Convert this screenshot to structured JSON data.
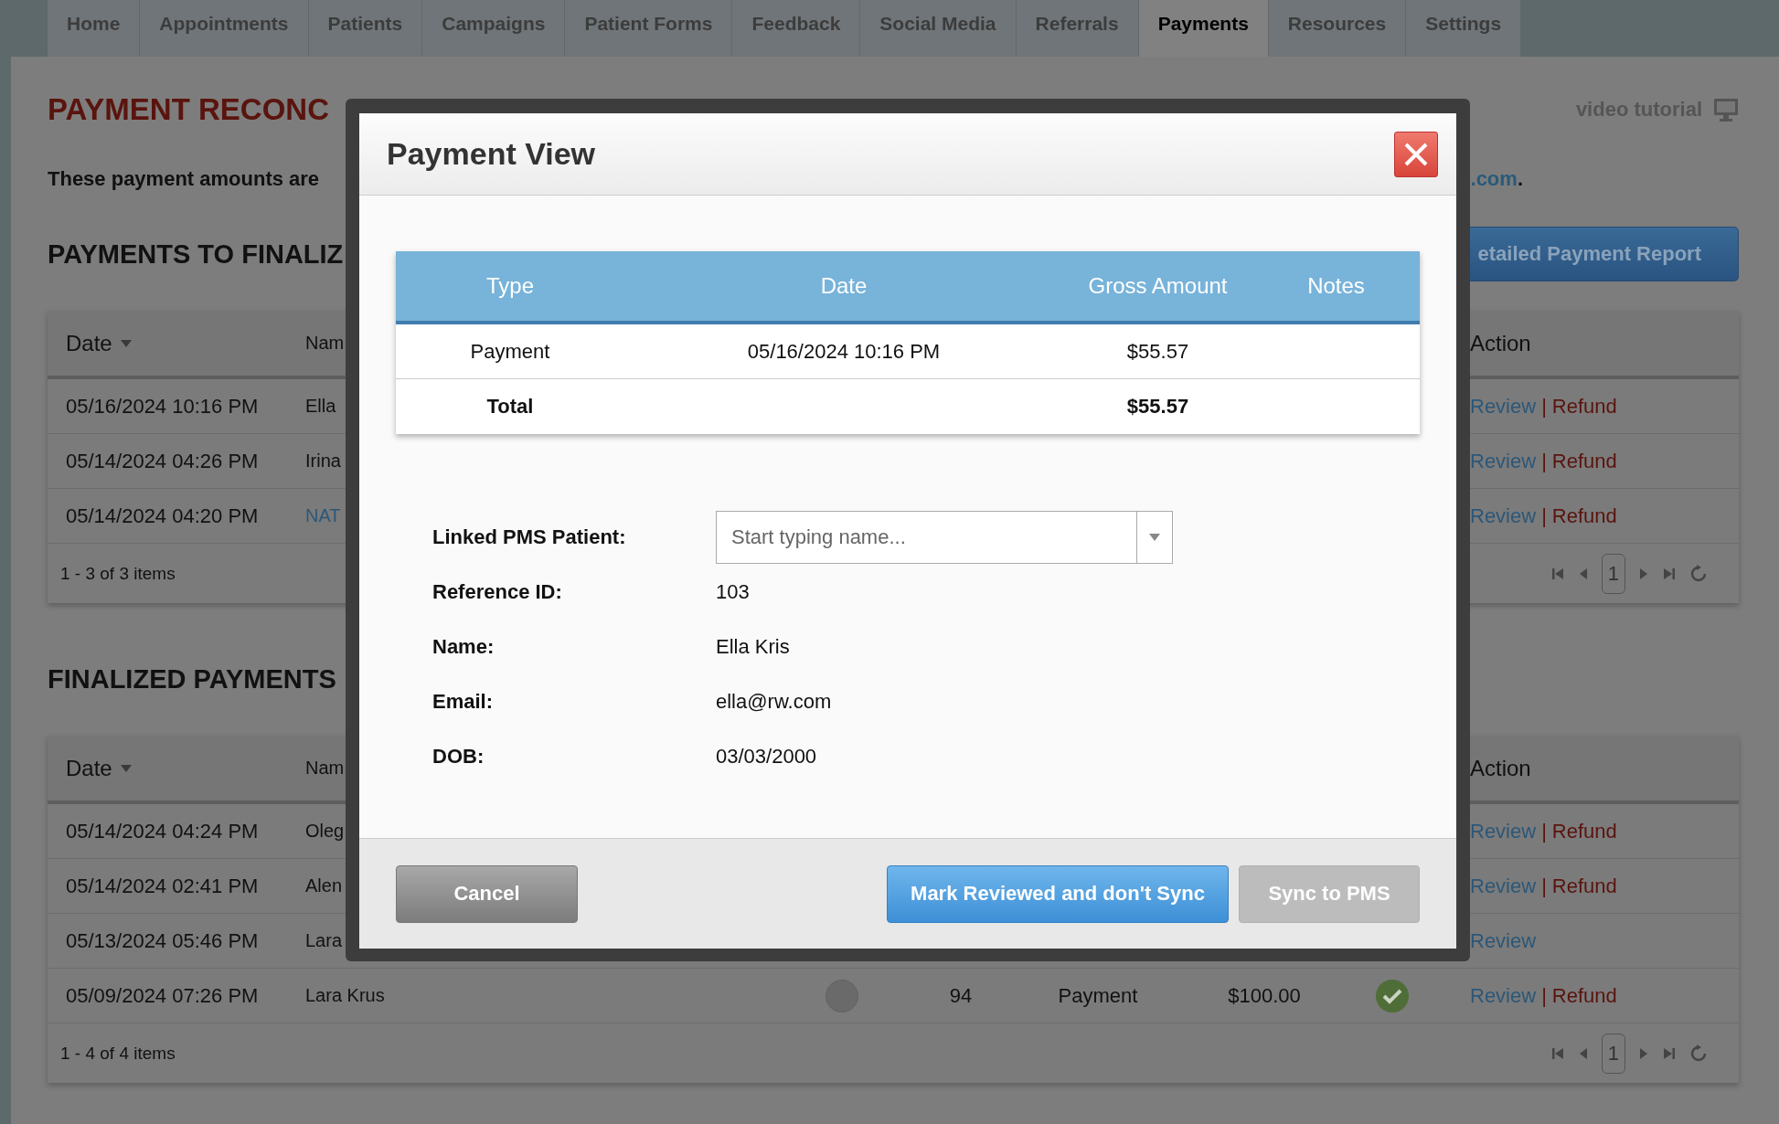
{
  "nav": {
    "tabs": [
      {
        "label": "Home",
        "selected": false
      },
      {
        "label": "Appointments",
        "selected": false
      },
      {
        "label": "Patients",
        "selected": false
      },
      {
        "label": "Campaigns",
        "selected": false
      },
      {
        "label": "Patient Forms",
        "selected": false
      },
      {
        "label": "Feedback",
        "selected": false
      },
      {
        "label": "Social Media",
        "selected": false
      },
      {
        "label": "Referrals",
        "selected": false
      },
      {
        "label": "Payments",
        "selected": true
      },
      {
        "label": "Resources",
        "selected": false
      },
      {
        "label": "Settings",
        "selected": false
      }
    ]
  },
  "page": {
    "title": "PAYMENT RECONC",
    "video_tutorial": "video tutorial",
    "intro": "These payment amounts are",
    "intro_link": ".com",
    "intro_end": ".",
    "report_button": "etailed Payment Report"
  },
  "sections": [
    {
      "title": "PAYMENTS TO FINALIZ",
      "columns": {
        "date": "Date",
        "name": "Nam",
        "action": "Action"
      },
      "rows": [
        {
          "kind": "partial",
          "date": "05/16/2024 10:16 PM",
          "name": "Ella",
          "name_link": false,
          "actions": [
            {
              "label": "Review",
              "kind": "review"
            },
            {
              "label": "|",
              "kind": "separator"
            },
            {
              "label": "Refund",
              "kind": "refund"
            }
          ]
        },
        {
          "kind": "partial",
          "date": "05/14/2024 04:26 PM",
          "name": "Irina",
          "name_link": false,
          "actions": [
            {
              "label": "Review",
              "kind": "review"
            },
            {
              "label": "|",
              "kind": "separator"
            },
            {
              "label": "Refund",
              "kind": "refund"
            }
          ]
        },
        {
          "kind": "partial",
          "date": "05/14/2024 04:20 PM",
          "name": "NAT",
          "name_link": true,
          "actions": [
            {
              "label": "Review",
              "kind": "review"
            },
            {
              "label": "|",
              "kind": "separator"
            },
            {
              "label": "Refund",
              "kind": "refund"
            }
          ]
        }
      ],
      "pager": {
        "summary": "1 - 3 of 3 items",
        "page": "1"
      }
    },
    {
      "title": "FINALIZED PAYMENTS",
      "columns": {
        "date": "Date",
        "name": "Nam",
        "action": "Action"
      },
      "rows": [
        {
          "kind": "partial",
          "date": "05/14/2024 04:24 PM",
          "name": "Oleg",
          "name_link": false,
          "actions": [
            {
              "label": "Review",
              "kind": "review"
            },
            {
              "label": "|",
              "kind": "separator"
            },
            {
              "label": "Refund",
              "kind": "refund"
            }
          ]
        },
        {
          "kind": "partial",
          "date": "05/14/2024 02:41 PM",
          "name": "Alen",
          "name_link": false,
          "actions": [
            {
              "label": "Review",
              "kind": "review"
            },
            {
              "label": "|",
              "kind": "separator"
            },
            {
              "label": "Refund",
              "kind": "refund"
            }
          ]
        },
        {
          "kind": "partial",
          "date": "05/13/2024 05:46 PM",
          "name": "Lara",
          "name_link": false,
          "actions": [
            {
              "label": "Review",
              "kind": "review"
            }
          ]
        },
        {
          "kind": "full",
          "date": "05/09/2024 07:26 PM",
          "name": "Lara Krus",
          "name_link": false,
          "synced": false,
          "reference": "94",
          "type": "Payment",
          "amount": "$100.00",
          "reviewed": true,
          "actions": [
            {
              "label": "Review",
              "kind": "review"
            },
            {
              "label": "|",
              "kind": "separator"
            },
            {
              "label": "Refund",
              "kind": "refund"
            }
          ]
        }
      ],
      "pager": {
        "summary": "1 - 4 of 4 items",
        "page": "1"
      }
    }
  ],
  "modal": {
    "title": "Payment View",
    "table": {
      "columns": [
        "Type",
        "Date",
        "Gross Amount",
        "Notes"
      ],
      "rows": [
        {
          "kind": "item",
          "cells": [
            "Payment",
            "05/16/2024 10:16 PM",
            "$55.57",
            ""
          ]
        },
        {
          "kind": "total",
          "cells": [
            "Total",
            "",
            "$55.57",
            ""
          ]
        }
      ]
    },
    "patient_field": {
      "label": "Linked PMS Patient:",
      "placeholder": "Start typing name..."
    },
    "details": [
      {
        "label": "Reference ID:",
        "value": "103"
      },
      {
        "label": "Name:",
        "value": "Ella Kris"
      },
      {
        "label": "Email:",
        "value": "ella@rw.com"
      },
      {
        "label": "DOB:",
        "value": "03/03/2000"
      }
    ],
    "buttons": [
      {
        "label": "Cancel",
        "kind": "cancel",
        "disabled": false
      },
      {
        "label": "Mark Reviewed and don't Sync",
        "kind": "primary",
        "disabled": false
      },
      {
        "label": "Sync to PMS",
        "kind": "primary",
        "disabled": true
      }
    ]
  }
}
